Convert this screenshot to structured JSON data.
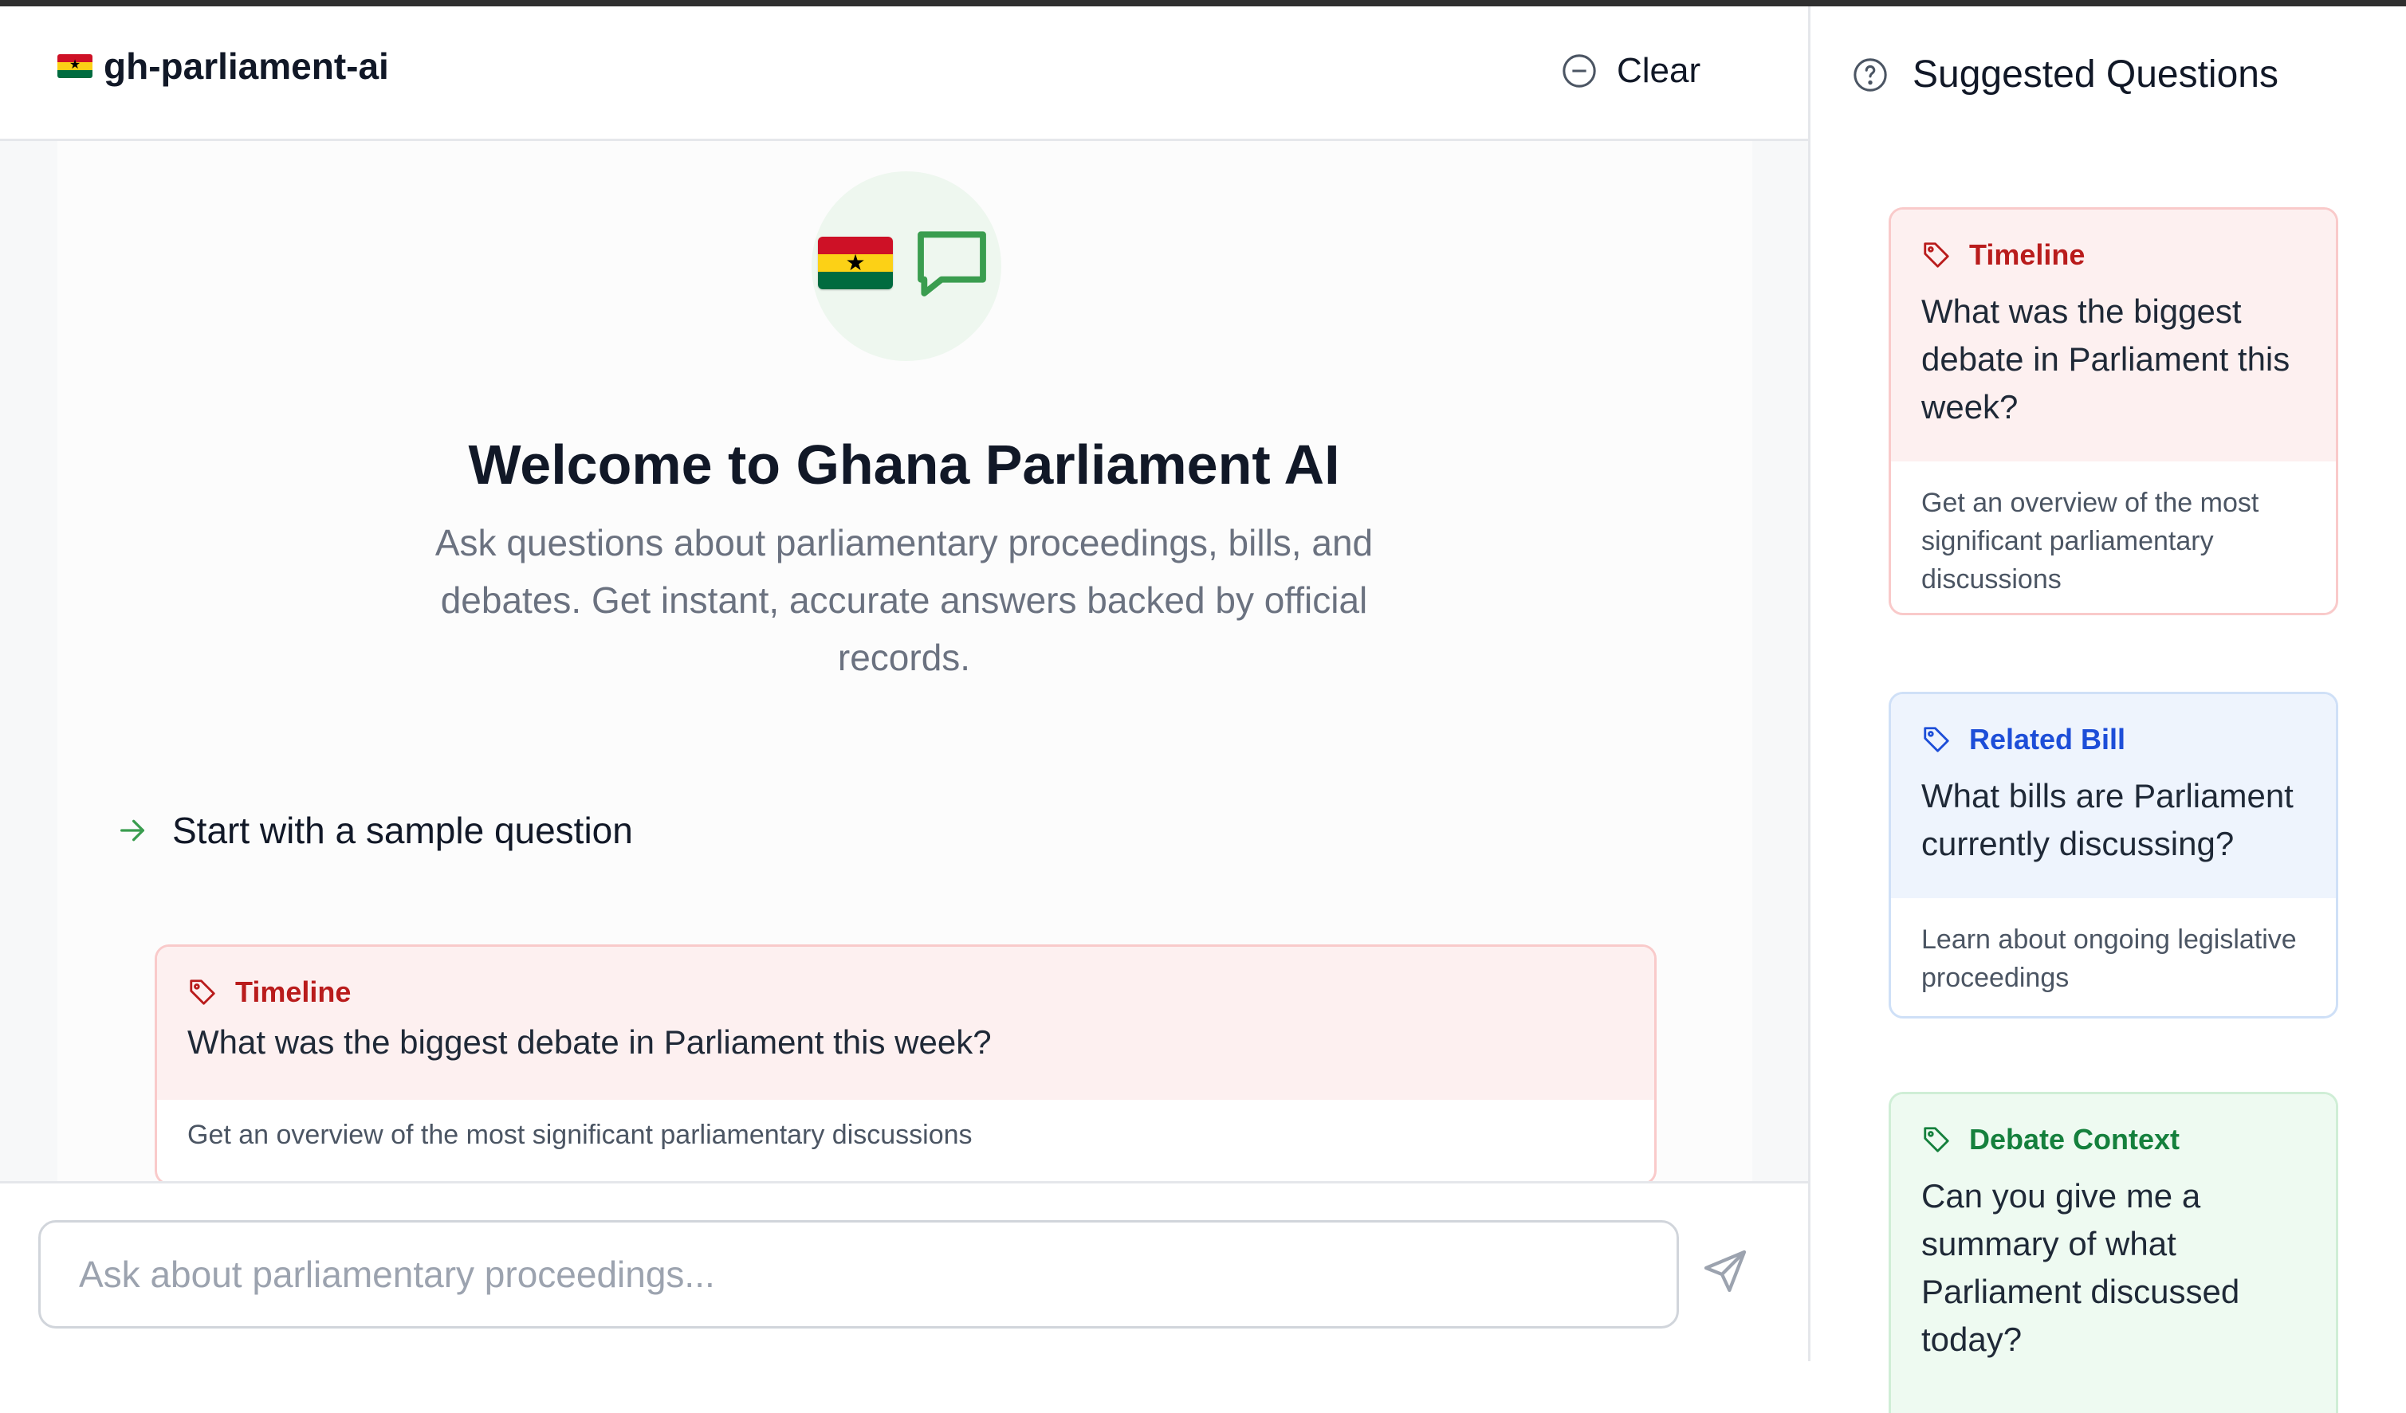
{
  "app": {
    "name": "gh-parliament-ai"
  },
  "header": {
    "clear_label": "Clear"
  },
  "welcome": {
    "title": "Welcome to Ghana Parliament AI",
    "subtitle": "Ask questions about parliamentary proceedings, bills, and debates. Get instant, accurate answers backed by official records.",
    "sample_heading": "Start with a sample question"
  },
  "main_question": {
    "tag": "Timeline",
    "title": "What was the biggest debate in Parliament this week?",
    "description": "Get an overview of the most significant parliamentary discussions"
  },
  "input": {
    "placeholder": "Ask about parliamentary proceedings..."
  },
  "sidebar": {
    "title": "Suggested Questions",
    "cards": [
      {
        "tag": "Timeline",
        "title": "What was the biggest debate in Parliament this week?",
        "description": "Get an overview of the most significant parliamentary discussions",
        "accent": "#b91c1c"
      },
      {
        "tag": "Related Bill",
        "title": "What bills are Parliament currently discussing?",
        "description": "Learn about ongoing legislative proceedings",
        "accent": "#1d4ed8"
      },
      {
        "tag": "Debate Context",
        "title": "Can you give me a summary of what Parliament discussed today?",
        "description": "",
        "accent": "#15803d"
      }
    ]
  },
  "colors": {
    "timeline": "#b91c1c",
    "bill": "#1d4ed8",
    "debate": "#15803d",
    "accent_green": "#3a9d4f"
  }
}
